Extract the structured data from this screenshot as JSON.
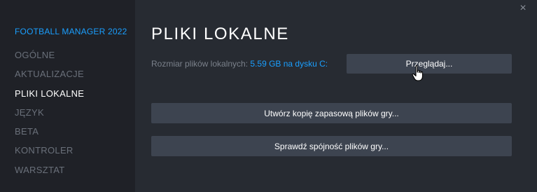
{
  "sidebar": {
    "game_title": "FOOTBALL MANAGER 2022",
    "items": [
      {
        "label": "OGÓLNE",
        "active": false
      },
      {
        "label": "AKTUALIZACJE",
        "active": false
      },
      {
        "label": "PLIKI LOKALNE",
        "active": true
      },
      {
        "label": "JĘZYK",
        "active": false
      },
      {
        "label": "BETA",
        "active": false
      },
      {
        "label": "KONTROLER",
        "active": false
      },
      {
        "label": "WARSZTAT",
        "active": false
      }
    ]
  },
  "main": {
    "title": "PLIKI LOKALNE",
    "size_label": "Rozmiar plików lokalnych:",
    "size_value": "5.59 GB na dysku C:",
    "browse_button": "Przeglądaj...",
    "backup_button": "Utwórz kopię zapasową plików gry...",
    "verify_button": "Sprawdź spójność plików gry..."
  },
  "window": {
    "close_symbol": "×"
  },
  "colors": {
    "accent": "#1a9fff",
    "sidebar_bg": "#1f2127",
    "main_bg": "#272b32",
    "button_bg": "#3d4450"
  }
}
